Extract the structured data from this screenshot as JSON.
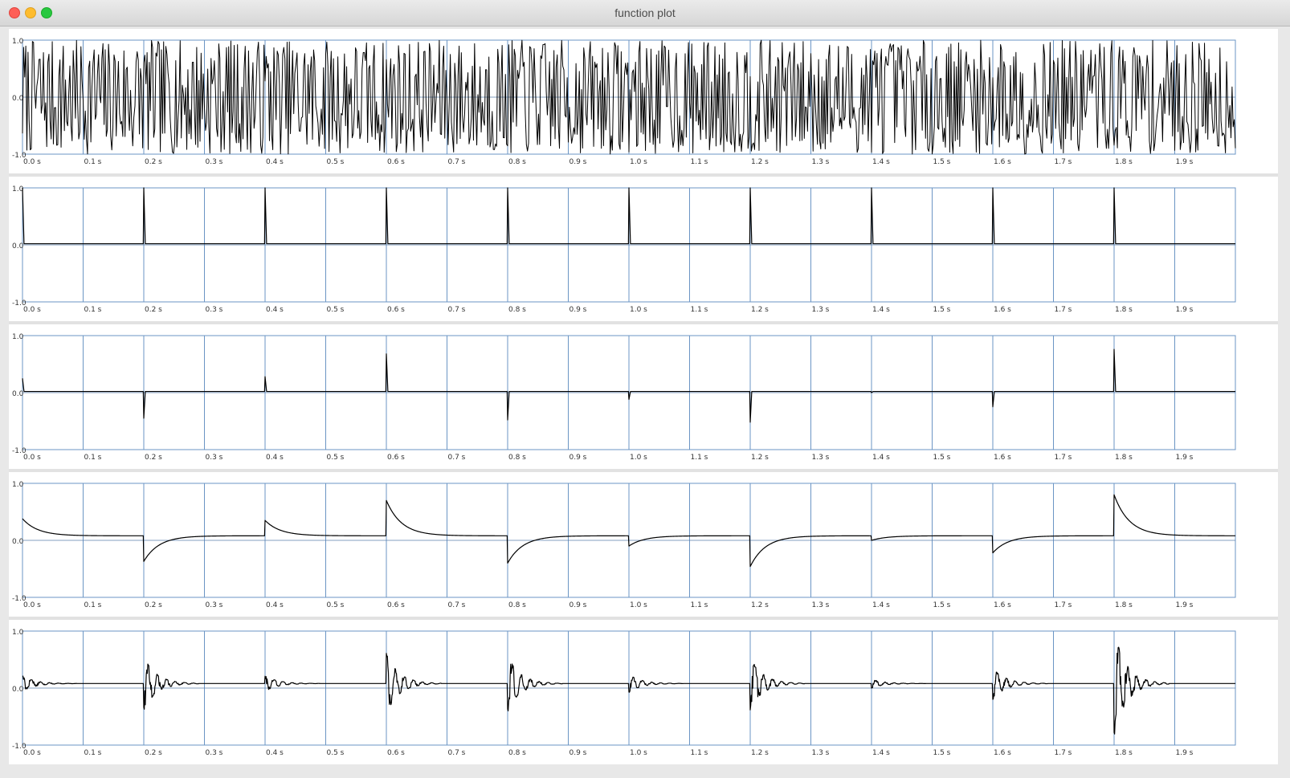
{
  "window": {
    "title": "function plot",
    "controls": {
      "close": "close-button",
      "minimize": "minimize-button",
      "zoom": "zoom-button"
    }
  },
  "colors": {
    "grid": "#6b95c4",
    "trace": "#000000",
    "panel": "#ffffff",
    "background": "#e2e2e2"
  },
  "chart_data": [
    {
      "type": "line",
      "x_unit": "s",
      "xlim": [
        0,
        2.0
      ],
      "ylim": [
        -1.0,
        1.0
      ],
      "x_ticks": [
        "0.0 s",
        "0.1 s",
        "0.2 s",
        "0.3 s",
        "0.4 s",
        "0.5 s",
        "0.6 s",
        "0.7 s",
        "0.8 s",
        "0.9 s",
        "1.0 s",
        "1.1 s",
        "1.2 s",
        "1.3 s",
        "1.4 s",
        "1.5 s",
        "1.6 s",
        "1.7 s",
        "1.8 s",
        "1.9 s"
      ],
      "y_ticks": [
        "1.0",
        "0.0",
        "-1.0"
      ],
      "signal": "noise",
      "amplitude_range": [
        -1.0,
        1.0
      ]
    },
    {
      "type": "line",
      "x_unit": "s",
      "xlim": [
        0,
        2.0
      ],
      "ylim": [
        -1.0,
        1.0
      ],
      "x_ticks": [
        "0.0 s",
        "0.1 s",
        "0.2 s",
        "0.3 s",
        "0.4 s",
        "0.5 s",
        "0.6 s",
        "0.7 s",
        "0.8 s",
        "0.9 s",
        "1.0 s",
        "1.1 s",
        "1.2 s",
        "1.3 s",
        "1.4 s",
        "1.5 s",
        "1.6 s",
        "1.7 s",
        "1.8 s",
        "1.9 s"
      ],
      "y_ticks": [
        "1.0",
        "0.0",
        "-1.0"
      ],
      "signal": "impulses",
      "baseline": 0.02,
      "events": [
        {
          "t": 0.0,
          "v": 1.0
        },
        {
          "t": 0.2,
          "v": 1.0
        },
        {
          "t": 0.4,
          "v": 1.0
        },
        {
          "t": 0.6,
          "v": 1.0
        },
        {
          "t": 0.8,
          "v": 1.0
        },
        {
          "t": 1.0,
          "v": 1.0
        },
        {
          "t": 1.2,
          "v": 1.0
        },
        {
          "t": 1.4,
          "v": 1.0
        },
        {
          "t": 1.6,
          "v": 1.0
        },
        {
          "t": 1.8,
          "v": 1.0
        }
      ]
    },
    {
      "type": "line",
      "x_unit": "s",
      "xlim": [
        0,
        2.0
      ],
      "ylim": [
        -1.0,
        1.0
      ],
      "x_ticks": [
        "0.0 s",
        "0.1 s",
        "0.2 s",
        "0.3 s",
        "0.4 s",
        "0.5 s",
        "0.6 s",
        "0.7 s",
        "0.8 s",
        "0.9 s",
        "1.0 s",
        "1.1 s",
        "1.2 s",
        "1.3 s",
        "1.4 s",
        "1.5 s",
        "1.6 s",
        "1.7 s",
        "1.8 s",
        "1.9 s"
      ],
      "y_ticks": [
        "1.0",
        "0.0",
        "-1.0"
      ],
      "signal": "impulses",
      "baseline": 0.02,
      "events": [
        {
          "t": 0.0,
          "v": 0.25
        },
        {
          "t": 0.2,
          "v": -0.45
        },
        {
          "t": 0.4,
          "v": 0.28
        },
        {
          "t": 0.6,
          "v": 0.68
        },
        {
          "t": 0.8,
          "v": -0.48
        },
        {
          "t": 1.0,
          "v": -0.12
        },
        {
          "t": 1.2,
          "v": -0.52
        },
        {
          "t": 1.4,
          "v": 0.0
        },
        {
          "t": 1.6,
          "v": -0.25
        },
        {
          "t": 1.8,
          "v": 0.76
        }
      ]
    },
    {
      "type": "line",
      "x_unit": "s",
      "xlim": [
        0,
        2.0
      ],
      "ylim": [
        -1.0,
        1.0
      ],
      "x_ticks": [
        "0.0 s",
        "0.1 s",
        "0.2 s",
        "0.3 s",
        "0.4 s",
        "0.5 s",
        "0.6 s",
        "0.7 s",
        "0.8 s",
        "0.9 s",
        "1.0 s",
        "1.1 s",
        "1.2 s",
        "1.3 s",
        "1.4 s",
        "1.5 s",
        "1.6 s",
        "1.7 s",
        "1.8 s",
        "1.9 s"
      ],
      "y_ticks": [
        "1.0",
        "0.0",
        "-1.0"
      ],
      "signal": "decay",
      "baseline": 0.08,
      "events": [
        {
          "t": 0.0,
          "v": 0.38
        },
        {
          "t": 0.2,
          "v": -0.37
        },
        {
          "t": 0.4,
          "v": 0.35
        },
        {
          "t": 0.6,
          "v": 0.7
        },
        {
          "t": 0.8,
          "v": -0.4
        },
        {
          "t": 1.0,
          "v": -0.1
        },
        {
          "t": 1.2,
          "v": -0.46
        },
        {
          "t": 1.4,
          "v": 0.0
        },
        {
          "t": 1.6,
          "v": -0.22
        },
        {
          "t": 1.8,
          "v": 0.8
        }
      ]
    },
    {
      "type": "line",
      "x_unit": "s",
      "xlim": [
        0,
        2.0
      ],
      "ylim": [
        -1.0,
        1.0
      ],
      "x_ticks": [
        "0.0 s",
        "0.1 s",
        "0.2 s",
        "0.3 s",
        "0.4 s",
        "0.5 s",
        "0.6 s",
        "0.7 s",
        "0.8 s",
        "0.9 s",
        "1.0 s",
        "1.1 s",
        "1.2 s",
        "1.3 s",
        "1.4 s",
        "1.5 s",
        "1.6 s",
        "1.7 s",
        "1.8 s",
        "1.9 s"
      ],
      "y_ticks": [
        "1.0",
        "0.0",
        "-1.0"
      ],
      "signal": "ringing",
      "baseline": 0.08,
      "events": [
        {
          "t": 0.0,
          "v": 0.22
        },
        {
          "t": 0.2,
          "v": -0.4
        },
        {
          "t": 0.4,
          "v": 0.22
        },
        {
          "t": 0.6,
          "v": 0.62
        },
        {
          "t": 0.8,
          "v": -0.42
        },
        {
          "t": 1.0,
          "v": -0.08
        },
        {
          "t": 1.2,
          "v": -0.4
        },
        {
          "t": 1.4,
          "v": 0.0
        },
        {
          "t": 1.6,
          "v": -0.2
        },
        {
          "t": 1.8,
          "v": -0.85
        }
      ]
    }
  ]
}
